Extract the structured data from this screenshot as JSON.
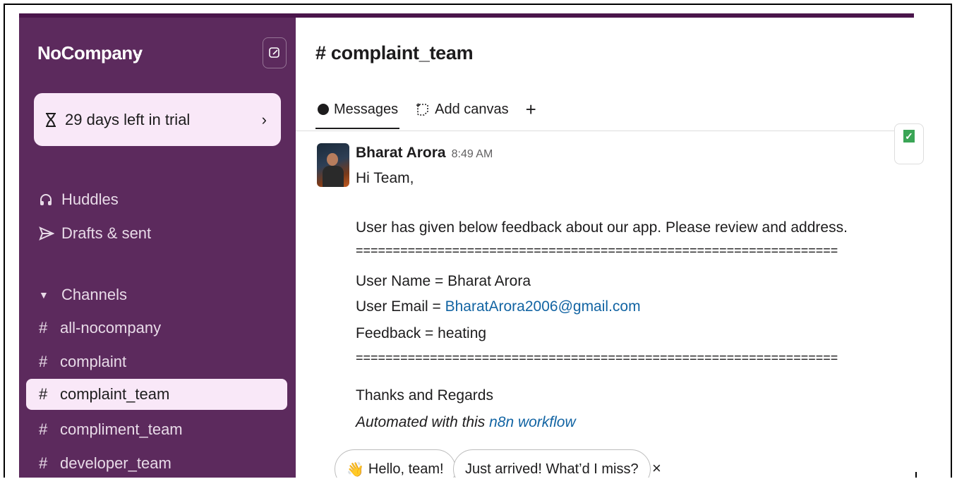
{
  "workspace": {
    "name": "NoCompany"
  },
  "trial": {
    "text": "29 days left in trial"
  },
  "nav": {
    "huddles": "Huddles",
    "drafts": "Drafts & sent"
  },
  "channels": {
    "header": "Channels",
    "items": [
      {
        "name": "all-nocompany",
        "active": false
      },
      {
        "name": "complaint",
        "active": false
      },
      {
        "name": "complaint_team",
        "active": true
      },
      {
        "name": "compliment_team",
        "active": false
      },
      {
        "name": "developer_team",
        "active": false
      }
    ]
  },
  "channel": {
    "title": "# complaint_team"
  },
  "tabs": {
    "messages": "Messages",
    "add_canvas": "Add canvas",
    "plus": "+"
  },
  "message": {
    "author": "Bharat Arora",
    "time": "8:49 AM",
    "greeting": "Hi Team,",
    "intro": "User has given below feedback about our app. Please review and address.",
    "separator": "=================================================================",
    "user_name": "User Name = Bharat Arora",
    "user_email_label": "User Email = ",
    "user_email": "BharatArora2006@gmail.com",
    "feedback": "Feedback = heating",
    "thanks": "Thanks and Regards",
    "automated_prefix": "Automated with this ",
    "automated_link": "n8n workflow"
  },
  "suggestions": {
    "hello": "Hello, team!",
    "arrived": "Just arrived! What’d I miss?",
    "dismiss": "×"
  }
}
